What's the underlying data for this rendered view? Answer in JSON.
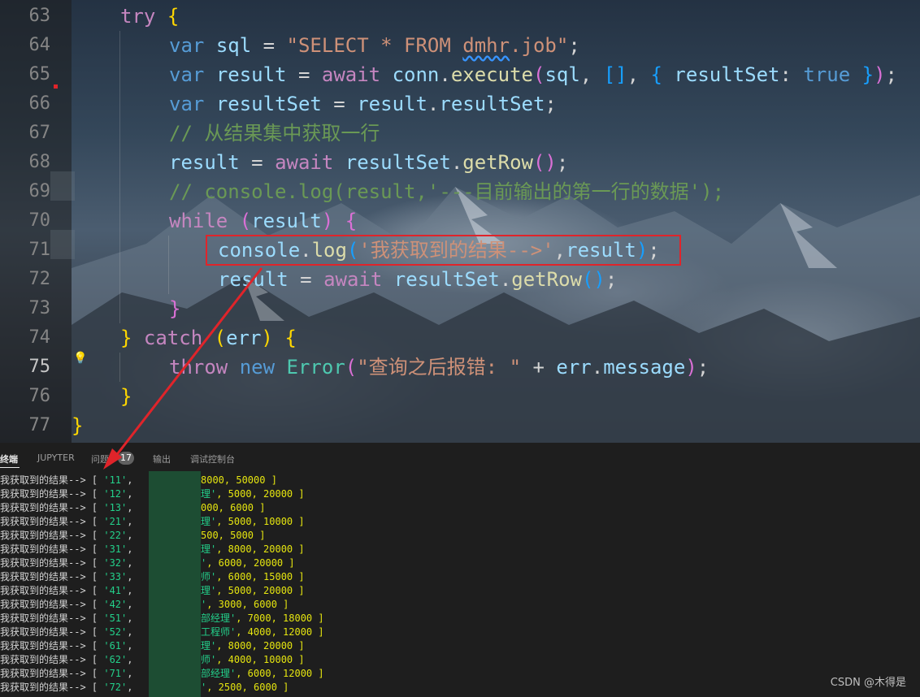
{
  "editor": {
    "active_line": "75",
    "lines": [
      {
        "num": "63",
        "indent": 1,
        "tokens": [
          [
            "ctl",
            "try"
          ],
          [
            "plain",
            " "
          ],
          [
            "br1",
            "{"
          ]
        ]
      },
      {
        "num": "64",
        "indent": 2,
        "tokens": [
          [
            "kw",
            "var"
          ],
          [
            "plain",
            " "
          ],
          [
            "var",
            "sql"
          ],
          [
            "plain",
            " = "
          ],
          [
            "str",
            "\"SELECT * FROM "
          ],
          [
            "str squig",
            "dmhr"
          ],
          [
            "str",
            ".job\""
          ],
          [
            "plain",
            ";"
          ]
        ]
      },
      {
        "num": "65",
        "indent": 2,
        "tokens": [
          [
            "kw",
            "var"
          ],
          [
            "plain",
            " "
          ],
          [
            "var",
            "result"
          ],
          [
            "plain",
            " = "
          ],
          [
            "ctl",
            "await"
          ],
          [
            "plain",
            " "
          ],
          [
            "var",
            "conn"
          ],
          [
            "plain",
            "."
          ],
          [
            "fn",
            "execute"
          ],
          [
            "br2",
            "("
          ],
          [
            "var",
            "sql"
          ],
          [
            "plain",
            ", "
          ],
          [
            "br3",
            "[]"
          ],
          [
            "plain",
            ", "
          ],
          [
            "br3",
            "{"
          ],
          [
            "plain",
            " "
          ],
          [
            "var",
            "resultSet"
          ],
          [
            "plain",
            ": "
          ],
          [
            "kw",
            "true"
          ],
          [
            "plain",
            " "
          ],
          [
            "br3",
            "}"
          ],
          [
            "br2",
            ")"
          ],
          [
            "plain",
            ";"
          ]
        ]
      },
      {
        "num": "66",
        "indent": 2,
        "tokens": [
          [
            "kw",
            "var"
          ],
          [
            "plain",
            " "
          ],
          [
            "var",
            "resultSet"
          ],
          [
            "plain",
            " = "
          ],
          [
            "var",
            "result"
          ],
          [
            "plain",
            "."
          ],
          [
            "var",
            "resultSet"
          ],
          [
            "plain",
            ";"
          ]
        ]
      },
      {
        "num": "67",
        "indent": 2,
        "tokens": [
          [
            "cm",
            "// 从结果集中获取一行"
          ]
        ]
      },
      {
        "num": "68",
        "indent": 2,
        "tokens": [
          [
            "var",
            "result"
          ],
          [
            "plain",
            " = "
          ],
          [
            "ctl",
            "await"
          ],
          [
            "plain",
            " "
          ],
          [
            "var",
            "resultSet"
          ],
          [
            "plain",
            "."
          ],
          [
            "fn",
            "getRow"
          ],
          [
            "br2",
            "()"
          ],
          [
            "plain",
            ";"
          ]
        ]
      },
      {
        "num": "69",
        "indent": 2,
        "tokens": [
          [
            "cm",
            "// console.log(result,'---目前输出的第一行的数据');"
          ]
        ]
      },
      {
        "num": "70",
        "indent": 2,
        "tokens": [
          [
            "ctl",
            "while"
          ],
          [
            "plain",
            " "
          ],
          [
            "br2",
            "("
          ],
          [
            "var",
            "result"
          ],
          [
            "br2",
            ")"
          ],
          [
            "plain",
            " "
          ],
          [
            "br2",
            "{"
          ]
        ]
      },
      {
        "num": "71",
        "indent": 3,
        "tokens": [
          [
            "var",
            "console"
          ],
          [
            "plain",
            "."
          ],
          [
            "fn",
            "log"
          ],
          [
            "br3",
            "("
          ],
          [
            "str",
            "'我获取到的结果-->'"
          ],
          [
            "plain",
            ","
          ],
          [
            "var",
            "result"
          ],
          [
            "br3",
            ")"
          ],
          [
            "plain",
            ";"
          ]
        ]
      },
      {
        "num": "72",
        "indent": 3,
        "tokens": [
          [
            "var",
            "result"
          ],
          [
            "plain",
            " = "
          ],
          [
            "ctl",
            "await"
          ],
          [
            "plain",
            " "
          ],
          [
            "var",
            "resultSet"
          ],
          [
            "plain",
            "."
          ],
          [
            "fn",
            "getRow"
          ],
          [
            "br3",
            "()"
          ],
          [
            "plain",
            ";"
          ]
        ]
      },
      {
        "num": "73",
        "indent": 2,
        "tokens": [
          [
            "br2",
            "}"
          ]
        ]
      },
      {
        "num": "74",
        "indent": 1,
        "tokens": [
          [
            "br1",
            "}"
          ],
          [
            "plain",
            " "
          ],
          [
            "ctl",
            "catch"
          ],
          [
            "plain",
            " "
          ],
          [
            "br1",
            "("
          ],
          [
            "var",
            "err"
          ],
          [
            "br1",
            ")"
          ],
          [
            "plain",
            " "
          ],
          [
            "br1",
            "{"
          ]
        ]
      },
      {
        "num": "75",
        "indent": 2,
        "tokens": [
          [
            "ctl",
            "throw"
          ],
          [
            "plain",
            " "
          ],
          [
            "kw",
            "new"
          ],
          [
            "plain",
            " "
          ],
          [
            "cls",
            "Error"
          ],
          [
            "br2",
            "("
          ],
          [
            "str",
            "\"查询之后报错: \""
          ],
          [
            "plain",
            " + "
          ],
          [
            "var",
            "err"
          ],
          [
            "plain",
            "."
          ],
          [
            "var",
            "message"
          ],
          [
            "br2",
            ")"
          ],
          [
            "plain",
            ";"
          ]
        ]
      },
      {
        "num": "76",
        "indent": 1,
        "tokens": [
          [
            "br1",
            "}"
          ]
        ]
      },
      {
        "num": "77",
        "indent": 0,
        "tokens": [
          [
            "br1",
            "}"
          ]
        ]
      }
    ]
  },
  "panel": {
    "tabs": [
      {
        "id": "terminal",
        "label": "终端",
        "active": true
      },
      {
        "id": "jupyter",
        "label": "JUPYTER",
        "active": false
      },
      {
        "id": "problems",
        "label": "问题",
        "active": false
      },
      {
        "id": "output",
        "label": "输出",
        "active": false
      },
      {
        "id": "debug",
        "label": "调试控制台",
        "active": false
      }
    ],
    "problems_badge": "17",
    "terminal_rows": [
      {
        "prefix": "我获取到的结果--> [ ",
        "id": "'11'",
        "rest": "8000, 50000 ]"
      },
      {
        "prefix": "我获取到的结果--> [ ",
        "id": "'12'",
        "rest": "理', 5000, 20000 ]"
      },
      {
        "prefix": "我获取到的结果--> [ ",
        "id": "'13'",
        "rest": "000, 6000 ]"
      },
      {
        "prefix": "我获取到的结果--> [ ",
        "id": "'21'",
        "rest": "理', 5000, 10000 ]"
      },
      {
        "prefix": "我获取到的结果--> [ ",
        "id": "'22'",
        "rest": "500, 5000 ]"
      },
      {
        "prefix": "我获取到的结果--> [ ",
        "id": "'31'",
        "rest": "理', 8000, 20000 ]"
      },
      {
        "prefix": "我获取到的结果--> [ ",
        "id": "'32'",
        "rest": "', 6000, 20000 ]"
      },
      {
        "prefix": "我获取到的结果--> [ ",
        "id": "'33'",
        "rest": "师', 6000, 15000 ]"
      },
      {
        "prefix": "我获取到的结果--> [ ",
        "id": "'41'",
        "rest": "理', 5000, 20000 ]"
      },
      {
        "prefix": "我获取到的结果--> [ ",
        "id": "'42'",
        "rest": "', 3000, 6000 ]"
      },
      {
        "prefix": "我获取到的结果--> [ ",
        "id": "'51'",
        "rest": "部经理', 7000, 18000 ]"
      },
      {
        "prefix": "我获取到的结果--> [ ",
        "id": "'52'",
        "rest": "工程师', 4000, 12000 ]"
      },
      {
        "prefix": "我获取到的结果--> [ ",
        "id": "'61'",
        "rest": "理', 8000, 20000 ]"
      },
      {
        "prefix": "我获取到的结果--> [ ",
        "id": "'62'",
        "rest": "师', 4000, 10000 ]"
      },
      {
        "prefix": "我获取到的结果--> [ ",
        "id": "'71'",
        "rest": "部经理', 6000, 12000 ]"
      },
      {
        "prefix": "我获取到的结果--> [ ",
        "id": "'72'",
        "rest": "', 2500, 6000 ]"
      }
    ]
  },
  "watermark": "CSDN @木得是",
  "colors": {
    "annotation": "#e0242a",
    "terminal_string": "#23d18b",
    "terminal_number": "#e5e510",
    "redaction": "#1d4d33"
  }
}
